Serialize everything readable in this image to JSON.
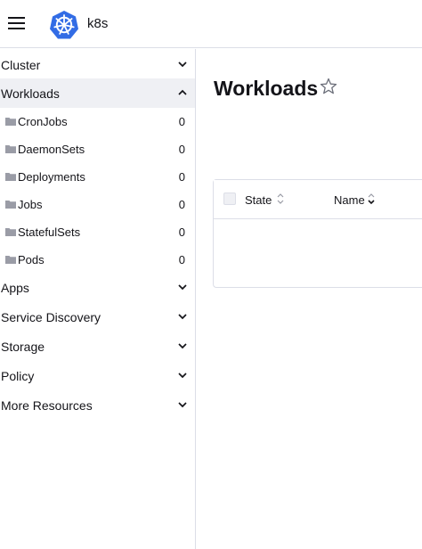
{
  "header": {
    "cluster_name": "k8s",
    "menu_icon": "hamburger-menu-icon",
    "logo_icon": "kubernetes-wheel-icon"
  },
  "sidebar": {
    "groups": [
      {
        "label": "Cluster",
        "expanded": false
      },
      {
        "label": "Workloads",
        "expanded": true
      },
      {
        "label": "Apps",
        "expanded": false
      },
      {
        "label": "Service Discovery",
        "expanded": false
      },
      {
        "label": "Storage",
        "expanded": false
      },
      {
        "label": "Policy",
        "expanded": false
      },
      {
        "label": "More Resources",
        "expanded": false
      }
    ],
    "workload_items": [
      {
        "label": "CronJobs",
        "count": "0"
      },
      {
        "label": "DaemonSets",
        "count": "0"
      },
      {
        "label": "Deployments",
        "count": "0"
      },
      {
        "label": "Jobs",
        "count": "0"
      },
      {
        "label": "StatefulSets",
        "count": "0"
      },
      {
        "label": "Pods",
        "count": "0"
      }
    ]
  },
  "main": {
    "title": "Workloads",
    "favorite_icon": "star-outline-icon",
    "table": {
      "columns": [
        {
          "label": "State",
          "sort_icon": "sort-both-icon"
        },
        {
          "label": "Name",
          "sort_icon": "sort-down-icon"
        }
      ],
      "rows": []
    }
  },
  "colors": {
    "logo_blue": "#326ce5",
    "active_group_bg": "#eff0f4",
    "border": "#dcdee7",
    "text": "#141419",
    "icon_grey": "#9a9ca6"
  }
}
